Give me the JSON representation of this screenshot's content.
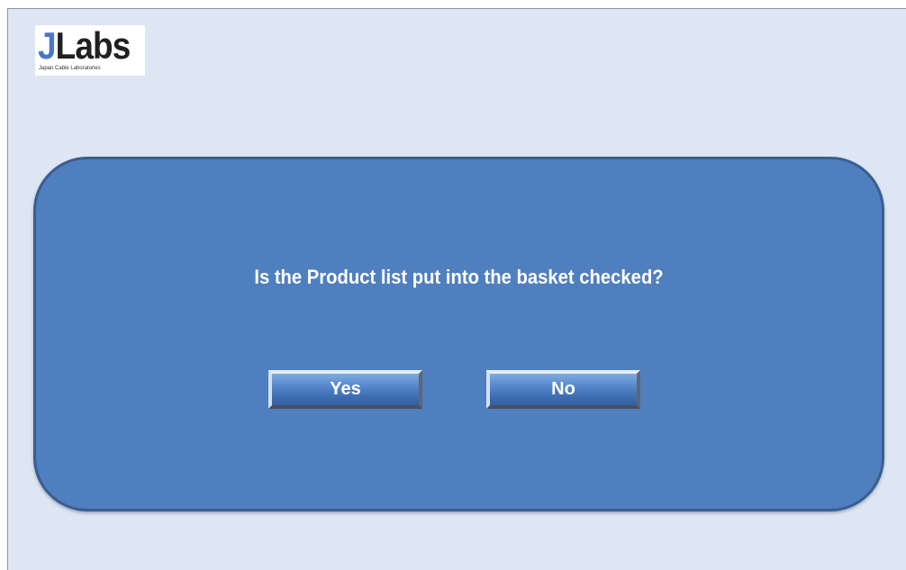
{
  "logo": {
    "mark_j": "J",
    "mark_rest": "Labs",
    "subtitle": "Japan Cable Laboratories"
  },
  "dialog": {
    "message": "Is the Product list put into the basket checked?",
    "yes_label": "Yes",
    "no_label": "No"
  },
  "colors": {
    "background": "#dde6f2",
    "dialog_fill": "#4f7fbf",
    "dialog_border": "#3a5e8f",
    "button_fill": "#4f7fbf",
    "text": "#ffffff",
    "logo_accent": "#4a78c8"
  }
}
